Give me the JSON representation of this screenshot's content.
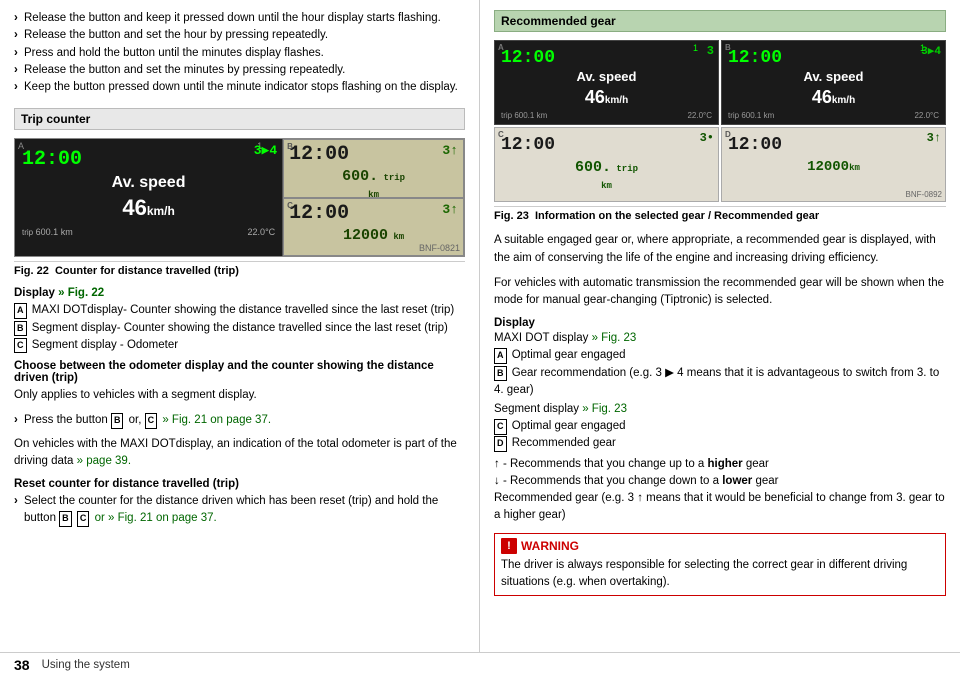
{
  "page": {
    "number": "38",
    "bottom_text": "Using the system"
  },
  "left": {
    "bullets": [
      "Release the button and keep it pressed down until the hour display starts flashing.",
      "Release the button and set the hour by pressing repeatedly.",
      "Press and hold the button until the minutes display flashes.",
      "Release the button and set the minutes by pressing repeatedly.",
      "Keep the button pressed down until the minute indicator stops flashing on the display."
    ],
    "trip_counter": {
      "header": "Trip counter",
      "fig_num": "Fig. 22",
      "fig_caption": "Counter for distance travelled (trip)",
      "display_A": {
        "label": "A",
        "time": "12:00",
        "gear": "3▶4",
        "speed_label": "Av. speed",
        "speed": "46",
        "unit": "km/h",
        "trip_label": "trip",
        "distance": "600.1",
        "dist_unit": "km",
        "temp": "22.0",
        "temp_unit": "°C",
        "index": "1"
      },
      "display_B": {
        "label": "B",
        "time": "12:00",
        "gear": "3↑",
        "number": "600.",
        "trip_label": "trip",
        "km_label": "km"
      },
      "display_C": {
        "label": "C",
        "time": "12:00",
        "gear": "3↑",
        "number": "12000",
        "unit": "km"
      },
      "bnf": "BNF-0821"
    },
    "display_section": {
      "header": "Display",
      "ref": "» Fig. 22",
      "items": [
        {
          "label": "A",
          "text": "MAXI DOTdisplay- Counter showing the distance travelled since the last reset (trip)"
        },
        {
          "label": "B",
          "text": "Segment display- Counter showing the distance travelled since the last reset (trip)"
        },
        {
          "label": "C",
          "text": "Segment display - Odometer"
        }
      ]
    },
    "choose_section": {
      "heading": "Choose between the odometer display and the counter showing the distance driven (trip)",
      "body": "Only applies to vehicles with a segment display.",
      "bullet": "Press the button",
      "b_label": "B",
      "or_text": "or,",
      "c_label": "C",
      "fig_ref": "» Fig. 21 on page 37."
    },
    "on_vehicles_text": "On vehicles with the MAXI DOTdisplay, an indication of the total odometer is part of the driving data",
    "page_ref": "» page 39.",
    "reset_section": {
      "heading": "Reset counter for distance travelled (trip)",
      "bullet1": "Select the counter for the distance driven which has been reset (trip) and hold the button",
      "b_label": "B",
      "c_label": "C",
      "or_fig": "or » Fig. 21 on page 37."
    }
  },
  "right": {
    "rec_gear": {
      "header": "Recommended gear",
      "fig_num": "Fig. 23",
      "fig_caption": "Information on the selected gear / Recommended gear",
      "bnf": "BNF-0892",
      "panels": [
        {
          "label": "A",
          "type": "dark",
          "time": "12:00",
          "gear": "3",
          "speed_label": "Av. speed",
          "speed": "46",
          "unit": "km/h",
          "trip": "600.1",
          "km": "km",
          "temp": "22.0",
          "temp_unit": "°C",
          "index": "1"
        },
        {
          "label": "B",
          "type": "dark",
          "time": "12:00",
          "gear": "3▶4",
          "speed_label": "Av. speed",
          "speed": "46",
          "unit": "km/h",
          "trip": "600.1",
          "km": "km",
          "temp": "22.0",
          "temp_unit": "°C",
          "index": "1"
        },
        {
          "label": "C",
          "type": "light",
          "time": "12:00",
          "gear": "3•",
          "big_number": "600.",
          "trip_label": "trip",
          "km_label": "km"
        },
        {
          "label": "D",
          "type": "light",
          "time": "12:00",
          "gear": "3↑",
          "big_number": "12000",
          "unit": "km"
        }
      ]
    },
    "body_text1": "A suitable engaged gear or, where appropriate, a recommended gear is displayed, with the aim of conserving the life of the engine and increasing driving efficiency.",
    "body_text2": "For vehicles with automatic transmission the recommended gear will be shown when the mode for manual gear-changing (Tiptronic) is selected.",
    "display_section": {
      "header": "Display",
      "maxi_ref": "MAXI DOT display » Fig. 23",
      "items": [
        {
          "label": "A",
          "text": "Optimal gear engaged"
        },
        {
          "label": "B",
          "text": "Gear recommendation (e.g. 3 ▶ 4 means that it is advantageous to switch from 3. to 4. gear)"
        }
      ]
    },
    "segment_section": {
      "header": "Segment display » Fig. 23",
      "items": [
        {
          "label": "C",
          "text": "Optimal gear engaged"
        },
        {
          "label": "D",
          "text": "Recommended gear"
        }
      ],
      "up_arrow": "↑",
      "up_text": "- Recommends that you change up to a",
      "up_bold": "higher",
      "up_end": "gear",
      "down_arrow": "↓",
      "down_text": "- Recommends that you change down to a",
      "down_bold": "lower",
      "down_end": "gear",
      "rec_text": "Recommended gear (e.g. 3 ↑ means that it would be beneficial to change from 3. gear to a higher gear)"
    },
    "warning": {
      "header": "WARNING",
      "text": "The driver is always responsible for selecting the correct gear in different driving situations (e.g. when overtaking)."
    }
  }
}
